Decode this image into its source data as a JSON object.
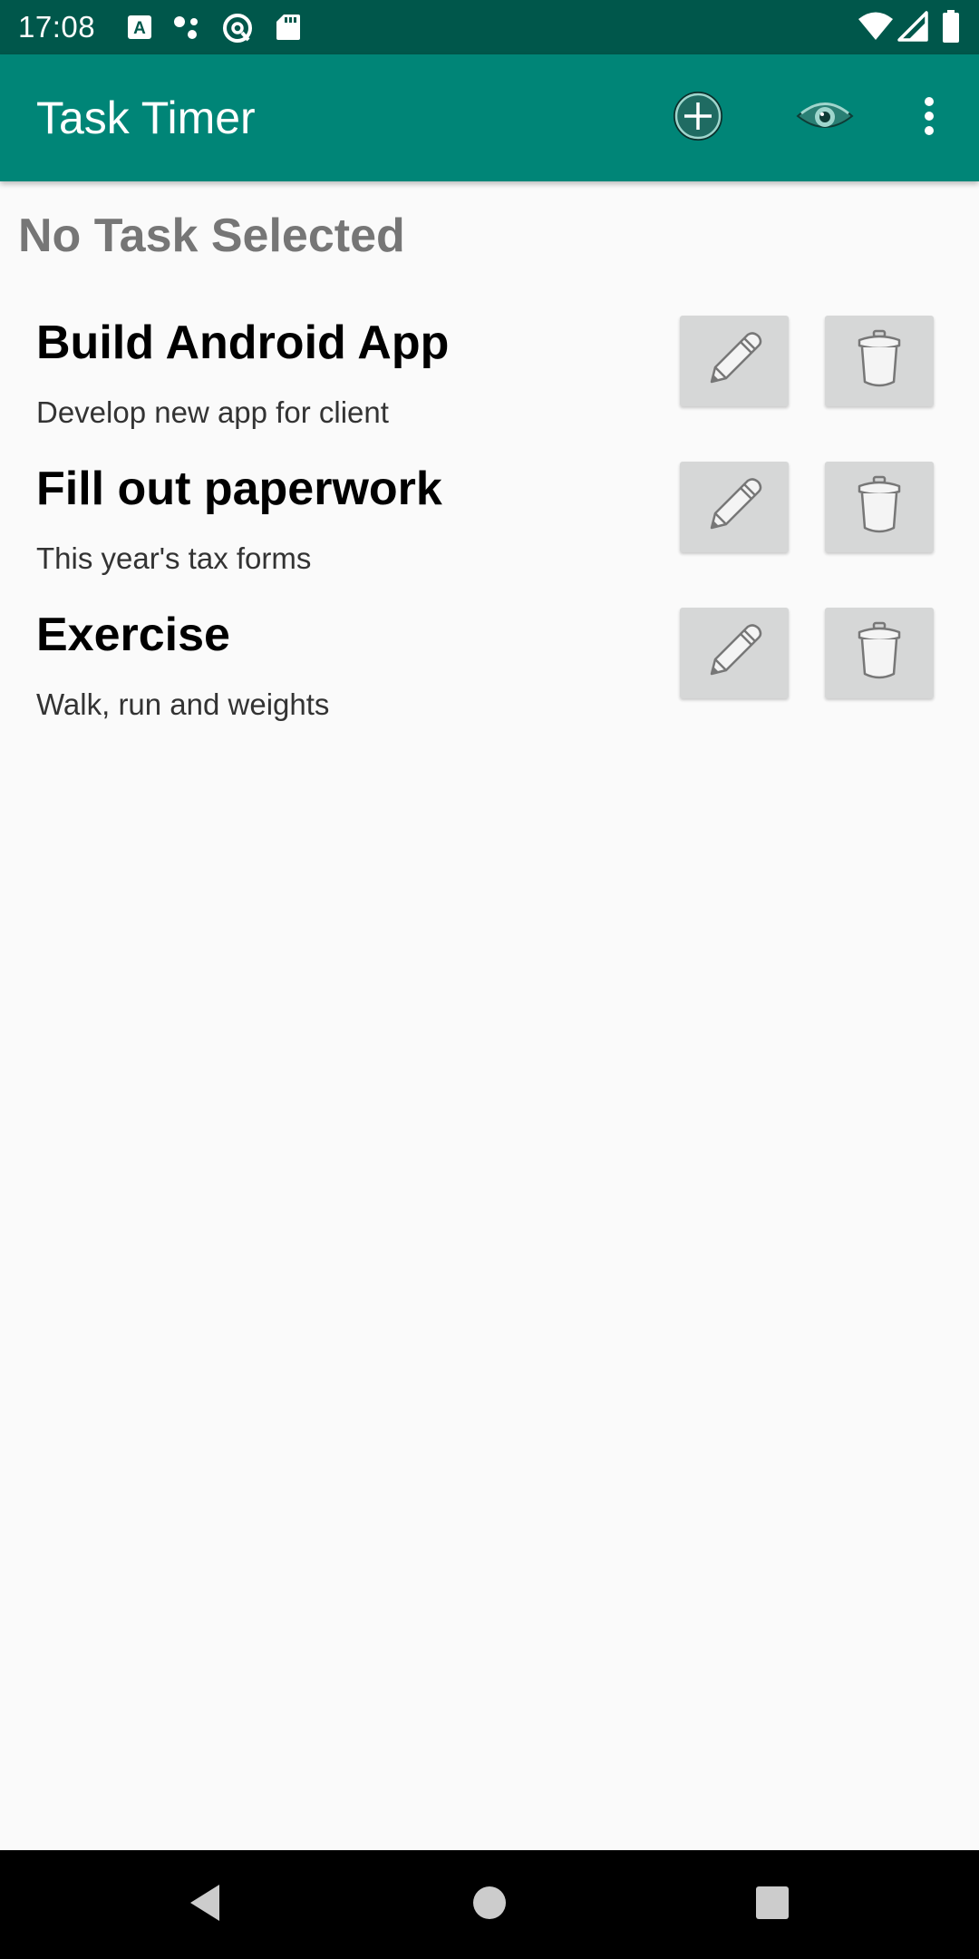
{
  "status_bar": {
    "time": "17:08",
    "icons": [
      "a-notification-icon",
      "dots-notification-icon",
      "at-notification-icon",
      "sd-card-icon",
      "wifi-icon",
      "signal-icon",
      "battery-icon"
    ]
  },
  "app_bar": {
    "title": "Task Timer",
    "actions": [
      "add-circle-icon",
      "eye-icon",
      "more-vert-icon"
    ]
  },
  "current_task_label": "No Task Selected",
  "tasks": [
    {
      "name": "Build Android App",
      "description": "Develop new app for client"
    },
    {
      "name": "Fill out paperwork",
      "description": "This year's tax forms"
    },
    {
      "name": "Exercise",
      "description": "Walk, run and weights"
    }
  ],
  "nav_bar": {
    "buttons": [
      "back-icon",
      "home-icon",
      "recents-icon"
    ]
  },
  "colors": {
    "status_bar": "#00574b",
    "app_bar": "#008577",
    "background": "#fafafa",
    "row_button": "#d6d7d7",
    "selected_label": "#767676"
  }
}
